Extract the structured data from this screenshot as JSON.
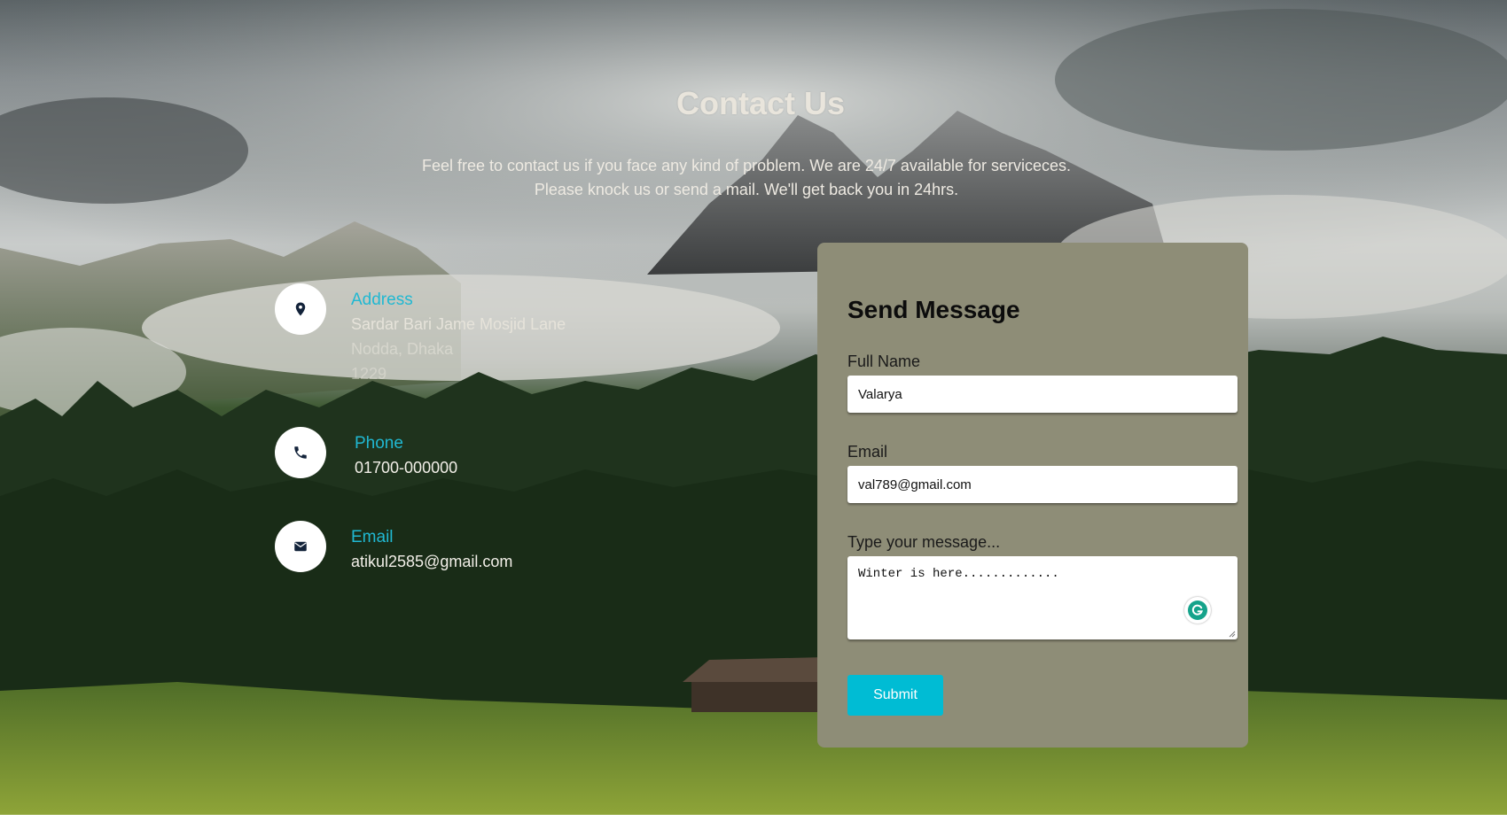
{
  "page": {
    "heading": "Contact Us",
    "intro_line1": "Feel free to contact us if you face any kind of problem. We are 24/7 available for serviceces.",
    "intro_line2": "Please knock us or send a mail. We'll get back you in 24hrs."
  },
  "contact_info": {
    "address": {
      "title": "Address",
      "line1": "Sardar Bari Jame Mosjid Lane",
      "line2": "Nodda, Dhaka",
      "line3": "1229",
      "icon": "map-pin-icon"
    },
    "phone": {
      "title": "Phone",
      "value": "01700-000000",
      "icon": "phone-icon"
    },
    "email": {
      "title": "Email",
      "value": "atikul2585@gmail.com",
      "icon": "envelope-icon"
    }
  },
  "form": {
    "title": "Send Message",
    "full_name_label": "Full Name",
    "full_name_value": "Valarya",
    "email_label": "Email",
    "email_value": "val789@gmail.com",
    "message_label": "Type your message...",
    "message_value": "Winter is here.............",
    "submit_label": "Submit"
  },
  "colors": {
    "accent": "#00bcd4",
    "card_background": "#8e8d77",
    "icon_dark": "#13233a"
  }
}
